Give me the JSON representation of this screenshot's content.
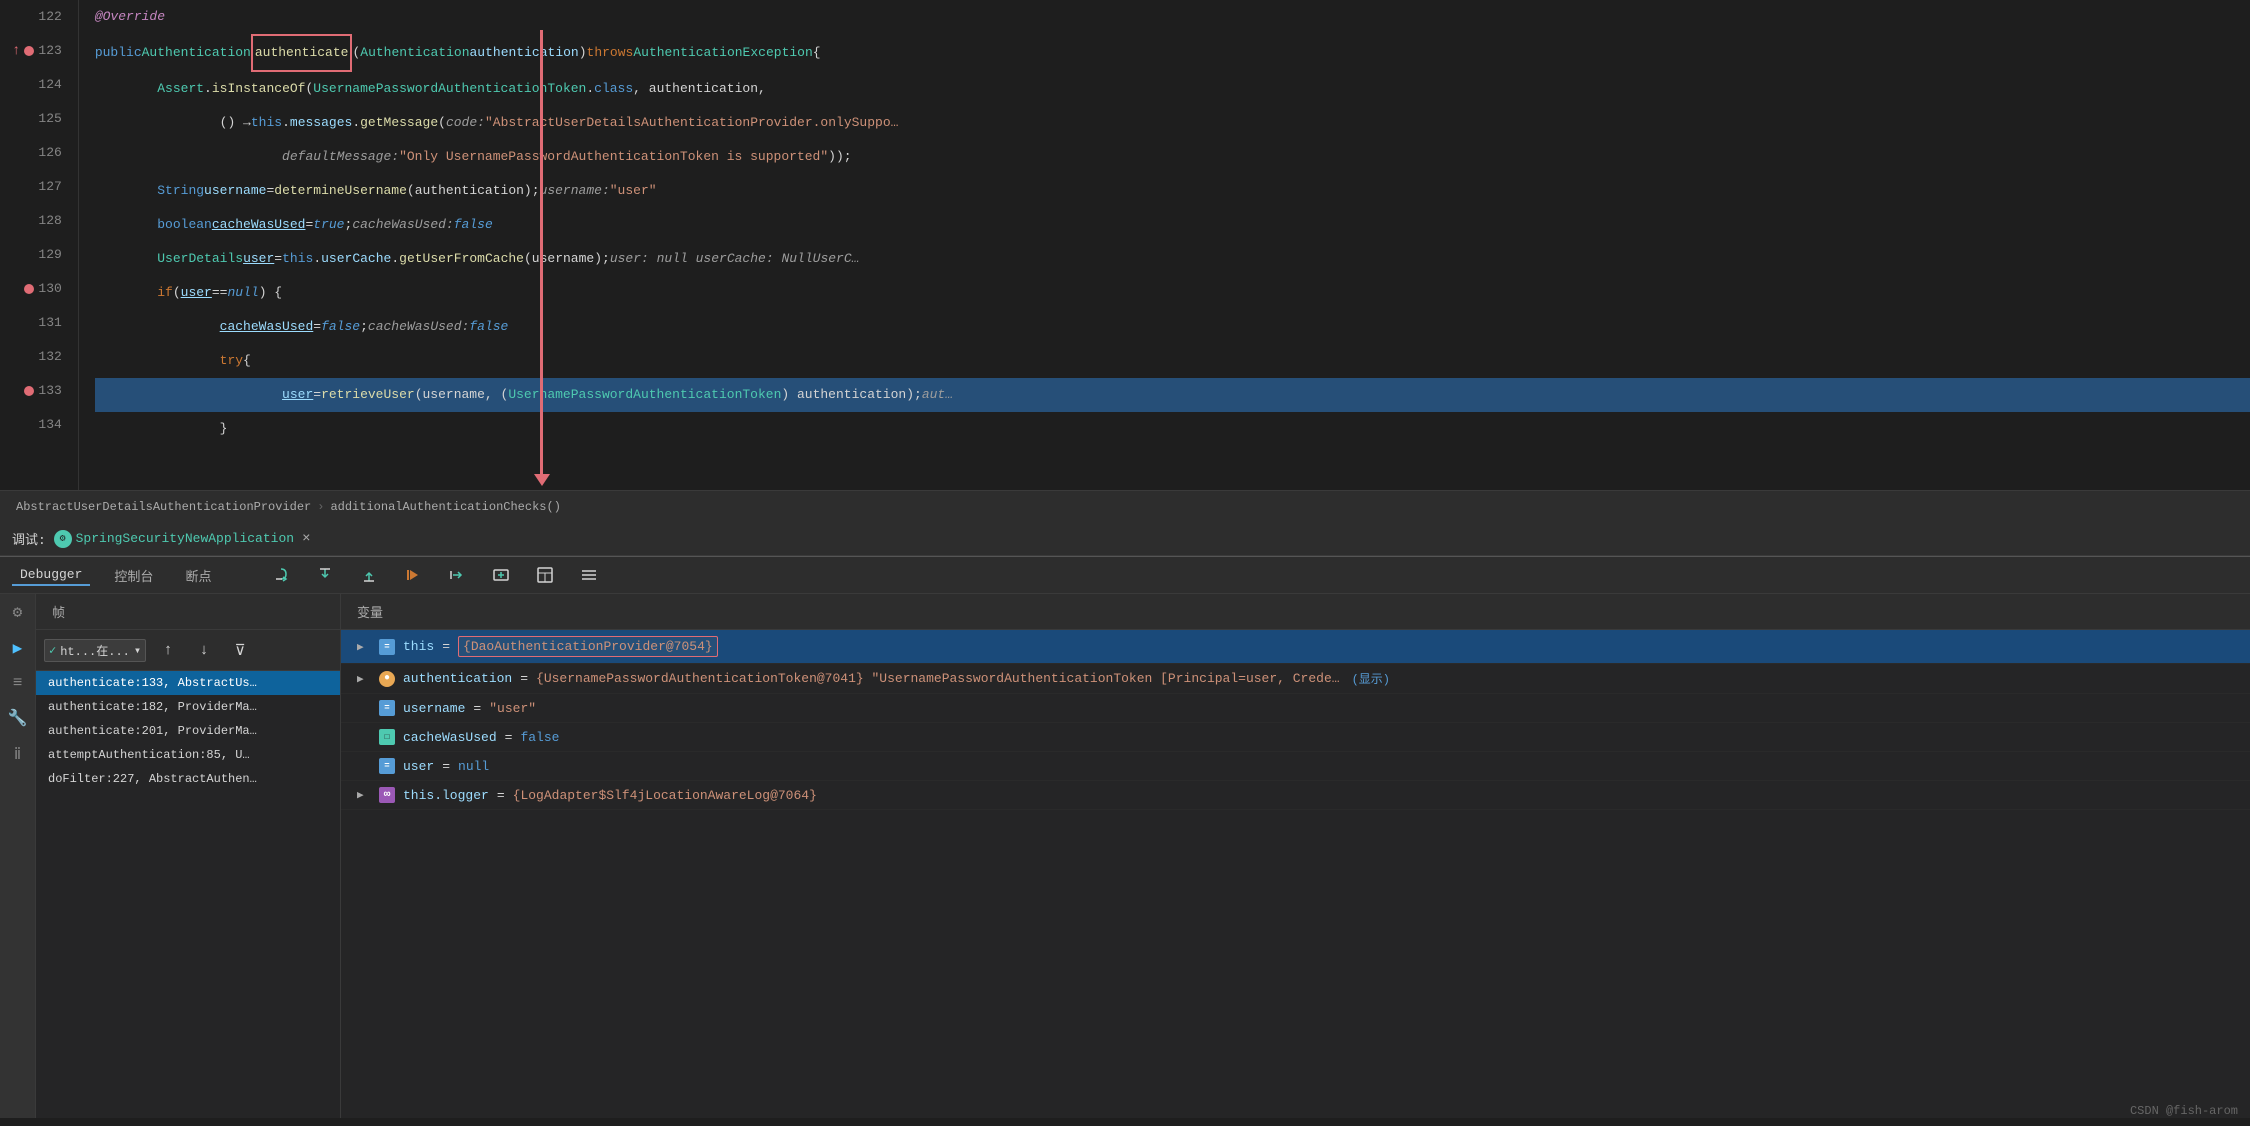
{
  "editor": {
    "lines": [
      {
        "num": "122",
        "indent": "",
        "content": "@Override",
        "class": "kw-override",
        "hasBreakpoint": false,
        "hasArrow": false
      },
      {
        "num": "123",
        "indent": "",
        "content": "public Authentication authenticate(Authentication authentication) throws AuthenticationException {",
        "hasBreakpoint": true,
        "hasArrow": true
      },
      {
        "num": "124",
        "indent": "    ",
        "content": "Assert.isInstanceOf(UsernamePasswordAuthenticationToken.class, authentication,",
        "hasBreakpoint": false,
        "hasArrow": false
      },
      {
        "num": "125",
        "indent": "        ",
        "content": "() → this.messages.getMessage( code: \"AbstractUserDetailsAuthenticationProvider.onlySuppo…",
        "hasBreakpoint": false,
        "hasArrow": false
      },
      {
        "num": "126",
        "indent": "            ",
        "content": "defaultMessage: \"Only UsernamePasswordAuthenticationToken is supported\"));",
        "hasBreakpoint": false,
        "hasArrow": false
      },
      {
        "num": "127",
        "indent": "    ",
        "content": "String username = determineUsername(authentication);    username: \"user\"",
        "hasBreakpoint": false,
        "hasArrow": false
      },
      {
        "num": "128",
        "indent": "    ",
        "content": "boolean cacheWasUsed = true;    cacheWasUsed: false",
        "hasBreakpoint": false,
        "hasArrow": false
      },
      {
        "num": "129",
        "indent": "    ",
        "content": "UserDetails user = this.userCache.getUserFromCache(username);    user: null    userCache: NullUserC…",
        "hasBreakpoint": false,
        "hasArrow": false
      },
      {
        "num": "130",
        "indent": "    ",
        "content": "if (user == null) {",
        "hasBreakpoint": true,
        "hasArrow": false
      },
      {
        "num": "131",
        "indent": "        ",
        "content": "cacheWasUsed = false;    cacheWasUsed: false",
        "hasBreakpoint": false,
        "hasArrow": false
      },
      {
        "num": "132",
        "indent": "        ",
        "content": "try {",
        "hasBreakpoint": false,
        "hasArrow": false
      },
      {
        "num": "133",
        "indent": "            ",
        "content": "user = retrieveUser(username, (UsernamePasswordAuthenticationToken) authentication);    aut…",
        "highlighted": true,
        "hasBreakpoint": true,
        "hasArrow": false
      },
      {
        "num": "134",
        "indent": "            ",
        "content": "}",
        "hasBreakpoint": false,
        "hasArrow": false
      }
    ]
  },
  "breadcrumb": {
    "part1": "AbstractUserDetailsAuthenticationProvider",
    "separator": "›",
    "part2": "additionalAuthenticationChecks()"
  },
  "debug": {
    "label": "调试:",
    "app_name": "SpringSecurityNewApplication",
    "close": "×"
  },
  "debugger_tabs": [
    {
      "id": "debugger",
      "label": "Debugger",
      "active": true
    },
    {
      "id": "console",
      "label": "控制台",
      "active": false
    },
    {
      "id": "breakpoints",
      "label": "断点",
      "active": false
    }
  ],
  "toolbar": {
    "buttons": [
      {
        "id": "resume",
        "icon": "▶",
        "title": "Resume"
      },
      {
        "id": "step-over",
        "icon": "↓",
        "title": "Step Over"
      },
      {
        "id": "step-into",
        "icon": "↙",
        "title": "Step Into"
      },
      {
        "id": "step-out",
        "icon": "↑",
        "title": "Step Out"
      },
      {
        "id": "run-to-cursor",
        "icon": "⇢",
        "title": "Run to Cursor"
      },
      {
        "id": "eval",
        "icon": "▿",
        "title": "Evaluate"
      },
      {
        "id": "table",
        "icon": "⊞",
        "title": "Table"
      },
      {
        "id": "settings",
        "icon": "≡",
        "title": "Settings"
      }
    ]
  },
  "frames": {
    "header": "帧",
    "filter_placeholder": "ht...在...",
    "items": [
      {
        "id": "authenticate-133",
        "label": "authenticate:133, AbstractUs…",
        "active": true
      },
      {
        "id": "authenticate-182",
        "label": "authenticate:182, ProviderMa…",
        "active": false
      },
      {
        "id": "authenticate-201",
        "label": "authenticate:201, ProviderMa…",
        "active": false
      },
      {
        "id": "attempt-85",
        "label": "attemptAuthentication:85, U…",
        "active": false
      },
      {
        "id": "dofilter-227",
        "label": "doFilter:227, AbstractAuthen…",
        "active": false
      }
    ]
  },
  "variables": {
    "header": "变量",
    "items": [
      {
        "id": "this",
        "icon_type": "equal",
        "name": "this",
        "value": "{DaoAuthenticationProvider@7054}",
        "highlighted": true,
        "expandable": true
      },
      {
        "id": "authentication",
        "icon_type": "circle",
        "name": "authentication",
        "value": "{UsernamePasswordAuthenticationToken@7041} \"UsernamePasswordAuthenticationToken [Principal=user, Crede…",
        "highlighted": false,
        "expandable": true,
        "has_display": true
      },
      {
        "id": "username",
        "icon_type": "equal",
        "name": "username",
        "value": "\"user\"",
        "highlighted": false,
        "expandable": false
      },
      {
        "id": "cacheWasUsed",
        "icon_type": "cyan",
        "name": "cacheWasUsed",
        "value": "false",
        "highlighted": false,
        "expandable": false
      },
      {
        "id": "user",
        "icon_type": "equal",
        "name": "user",
        "value": "null",
        "highlighted": false,
        "expandable": false
      },
      {
        "id": "this-logger",
        "icon_type": "infinity",
        "name": "this.logger",
        "value": "{LogAdapter$Slf4jLocationAwareLog@7064}",
        "highlighted": false,
        "expandable": true
      }
    ]
  },
  "side_icons": [
    {
      "id": "debug-icon",
      "symbol": "⚙",
      "active": false
    },
    {
      "id": "run-icon",
      "symbol": "▶",
      "active": true
    },
    {
      "id": "settings-icon",
      "symbol": "≡",
      "active": false
    },
    {
      "id": "wrench-icon",
      "symbol": "🔧",
      "active": false
    },
    {
      "id": "info-icon",
      "symbol": "ⅱ",
      "active": false
    }
  ],
  "watermark": {
    "text": "CSDN @fish-arom"
  }
}
